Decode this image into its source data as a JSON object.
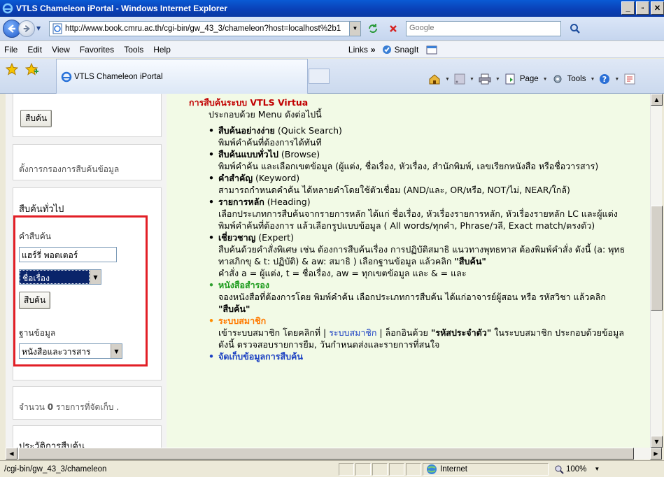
{
  "window": {
    "title": "VTLS Chameleon iPortal - Windows Internet Explorer",
    "buttons": [
      "_",
      "ð",
      "X"
    ]
  },
  "address": {
    "url": "http://www.book.cmru.ac.th/cgi-bin/gw_43_3/chameleon?host=localhost%2b1",
    "search_placeholder": "Google"
  },
  "menu": {
    "items": [
      "File",
      "Edit",
      "View",
      "Favorites",
      "Tools",
      "Help"
    ],
    "links_label": "Links",
    "links_chevron": "»",
    "snagit": "SnagIt"
  },
  "tab": {
    "title": "VTLS Chameleon iPortal"
  },
  "commandbar": {
    "page": "Page",
    "tools": "Tools"
  },
  "sidebar": {
    "top_button": "สืบค้น",
    "filter_link": "ตั้งการกรองการสืบค้นข้อมูล",
    "general_heading": "สืบค้นทั่วไป",
    "term_label": "คำสืบค้น",
    "term_value": "แฮร์รี่ พอตเตอร์",
    "field_select": "ชื่อเรื่อง",
    "search_button": "สืบค้น",
    "db_label": "ฐานข้อมูล",
    "db_select": "หนังสือและวารสาร",
    "saved_prefix": "จำนวน",
    "saved_count": "0",
    "saved_suffix": "รายการที่จัดเก็บ .",
    "history_heading": "ประวัติการสืบค้น"
  },
  "main": {
    "heading": "การสืบค้นระบบ VTLS Virtua",
    "subheading": "ประกอบด้วย Menu ดังต่อไปนี้",
    "items": [
      {
        "name": "สืบค้นอย่างง่าย",
        "en": " (Quick Search)",
        "desc": "พิมพ์คำค้นที่ต้องการได้ทันที"
      },
      {
        "name": "สืบค้นแบบทั่วไป",
        "en": " (Browse)",
        "desc": "พิมพ์คำค้น และเลือกเขตข้อมูล (ผู้แต่ง, ชื่อเรื่อง, หัวเรื่อง, สำนักพิมพ์, เลขเรียกหนังสือ หรือชื่อวารสาร)"
      },
      {
        "name": "คำสำคัญ",
        "en": " (Keyword)",
        "desc": "สามารถกำหนดคำค้น ได้หลายคำโดยใช้ตัวเชื่อม (AND/และ, OR/หรือ, NOT/ไม่, NEAR/ใกล้)"
      },
      {
        "name": "รายการหลัก",
        "en": " (Heading)",
        "desc": "เลือกประเภทการสืบค้นจากรายการหลัก ได้แก่ ชื่อเรื่อง, หัวเรื่องรายการหลัก, หัวเรื่องรายหลัก LC และผู้แต่ง พิมพ์คำค้นที่ต้องการ แล้วเลือกรูปแบบข้อมูล ( All words/ทุกคำ, Phrase/วลี, Exact match/ตรงตัว)"
      },
      {
        "name": "เชี่ยวชาญ",
        "en": " (Expert)",
        "desc": "สืบค้นด้วยคำสั่งพิเศษ เช่น ต้องการสืบค้นเรื่อง การปฏิบัติสมาธิ แนวทางพุทธทาส ต้องพิมพ์คำสั่ง ดังนี้ (a: พุทธทาสภิกขุ & t: ปฏิบัติ) & aw: สมาธิ ) เลือกฐานข้อมูล แล้วคลิก ",
        "desc_bold": "\"สืบค้น\"",
        "desc2": "คำสั่ง a = ผู้แต่ง, t = ชื่อเรื่อง, aw = ทุกเขตข้อมูล และ & = และ"
      },
      {
        "name": "หนังสือสำรอง",
        "en": "",
        "desc": "จองหนังสือที่ต้องการโดย พิมพ์คำค้น เลือกประเภทการสืบค้น ได้แก่อาจารย์ผู้สอน หรือ รหัสวิชา แล้วคลิก ",
        "desc_bold": "\"สืบค้น\""
      },
      {
        "name": "ระบบสมาชิก",
        "en": "",
        "desc_a": "เข้าระบบสมาชิก โดยคลิกที่ | ",
        "desc_link": "ระบบสมาชิก",
        "desc_b": " | ล็อกอินด้วย ",
        "desc_bold": "\"รหัสประจำตัว\"",
        "desc_c": " ในระบบสมาชิก ประกอบด้วยข้อมูล ดังนี้ ตรวจสอบรายการยืม, วันกำหนดส่งและรายการที่สนใจ"
      },
      {
        "name": "จัดเก็บข้อมูลการสืบค้น",
        "en": "",
        "desc": ""
      }
    ]
  },
  "status": {
    "path": "/cgi-bin/gw_43_3/chameleon",
    "zone": "Internet",
    "zoom": "100%"
  },
  "colors": {
    "heading_red": "#c10000",
    "highlight_box": "#e21f26",
    "main_bg": "#f2fae6",
    "link_blue": "#1a3fc2"
  }
}
